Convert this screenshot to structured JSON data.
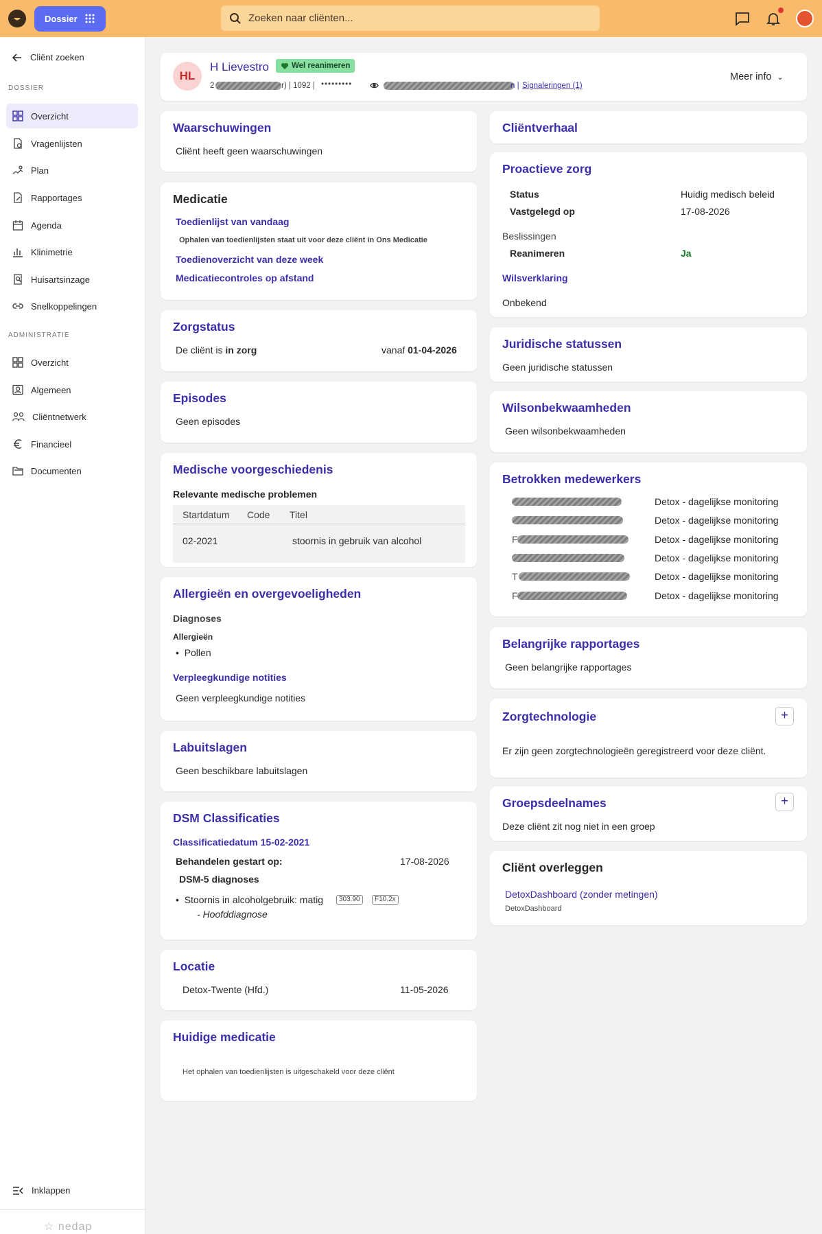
{
  "colors": {
    "topbar": "#f9bb6b",
    "accent": "#3a2fa8",
    "dossier_button": "#5b6cf2",
    "green": "#1c7a2a"
  },
  "topbar": {
    "dossier_label": "Dossier",
    "search_placeholder": "Zoeken naar cliënten..."
  },
  "sidebar": {
    "back_label": "Cliënt zoeken",
    "section_dossier": "DOSSIER",
    "dossier_items": [
      {
        "label": "Overzicht",
        "icon": "grid-icon",
        "active": true
      },
      {
        "label": "Vragenlijsten",
        "icon": "questionnaire-icon"
      },
      {
        "label": "Plan",
        "icon": "plan-icon"
      },
      {
        "label": "Rapportages",
        "icon": "report-icon"
      },
      {
        "label": "Agenda",
        "icon": "calendar-icon"
      },
      {
        "label": "Klinimetrie",
        "icon": "chart-icon"
      },
      {
        "label": "Huisartsinzage",
        "icon": "doctor-icon"
      },
      {
        "label": "Snelkoppelingen",
        "icon": "link-icon"
      }
    ],
    "section_admin": "ADMINISTRATIE",
    "admin_items": [
      {
        "label": "Overzicht",
        "icon": "grid-icon"
      },
      {
        "label": "Algemeen",
        "icon": "person-icon"
      },
      {
        "label": "Cliëntnetwerk",
        "icon": "network-icon"
      },
      {
        "label": "Financieel",
        "icon": "euro-icon"
      },
      {
        "label": "Documenten",
        "icon": "folder-icon"
      }
    ],
    "collapse_label": "Inklappen",
    "footer_brand": "nedap"
  },
  "client": {
    "initials": "HL",
    "name": "H Lievestro",
    "reanimeren_badge": "Wel reanimeren",
    "meta_prefix": "2",
    "meta_r": "r) | 1092 |",
    "meta_masked": "•••••••••",
    "meta_suffix": "n |",
    "signaleringen": "Signaleringen (1)",
    "meer_info": "Meer info"
  },
  "left": {
    "waarschuwingen": {
      "title": "Waarschuwingen",
      "text": "Cliënt heeft geen waarschuwingen"
    },
    "medicatie": {
      "title": "Medicatie",
      "link1": "Toedienlijst van vandaag",
      "note": "Ophalen van toedienlijsten staat uit voor deze cliënt in Ons Medicatie",
      "link2": "Toedienoverzicht van deze week",
      "link3": "Medicatiecontroles op afstand"
    },
    "zorgstatus": {
      "title": "Zorgstatus",
      "prefix": "De cliënt is",
      "status": "in zorg",
      "vanaf": "vanaf",
      "date": "01-04-2026"
    },
    "episodes": {
      "title": "Episodes",
      "text": "Geen episodes"
    },
    "voorgeschiedenis": {
      "title": "Medische voorgeschiedenis",
      "subtitle": "Relevante medische problemen",
      "headers": [
        "Startdatum",
        "Code",
        "Titel"
      ],
      "row": [
        "02-2021",
        "",
        "stoornis in gebruik van alcohol"
      ]
    },
    "allergieen": {
      "title": "Allergieën en overgevoeligheden",
      "diagnoses": "Diagnoses",
      "allergieen_label": "Allergieën",
      "item": "Pollen",
      "notities_link": "Verpleegkundige notities",
      "notities_text": "Geen verpleegkundige notities"
    },
    "labuitslagen": {
      "title": "Labuitslagen",
      "text": "Geen beschikbare labuitslagen"
    },
    "dsm": {
      "title": "DSM Classificaties",
      "date_label": "Classificatiedatum 15-02-2021",
      "behandelen_label": "Behandelen gestart op:",
      "behandelen_date": "17-08-2026",
      "dsm5": "DSM-5 diagnoses",
      "diagnose": "Stoornis in alcoholgebruik: matig",
      "code1": "303.90",
      "code2": "F10.2x",
      "hoofd": "- Hoofddiagnose"
    },
    "locatie": {
      "title": "Locatie",
      "name": "Detox-Twente (Hfd.)",
      "date": "11-05-2026"
    },
    "huidige_medicatie": {
      "title": "Huidige medicatie",
      "text": "Het ophalen van toedienlijsten is uitgeschakeld voor deze cliënt"
    }
  },
  "right": {
    "clientverhaal": {
      "title": "Cliëntverhaal"
    },
    "proactieve": {
      "title": "Proactieve zorg",
      "status_label": "Status",
      "status_value": "Huidig medisch beleid",
      "vastgelegd_label": "Vastgelegd op",
      "vastgelegd_value": "17-08-2026",
      "beslissingen": "Beslissingen",
      "reanimeren_label": "Reanimeren",
      "reanimeren_value": "Ja",
      "wilsverklaring": "Wilsverklaring",
      "onbekend": "Onbekend"
    },
    "juridische": {
      "title": "Juridische statussen",
      "text": "Geen juridische statussen"
    },
    "wilsonbekwaam": {
      "title": "Wilsonbekwaamheden",
      "text": "Geen wilsonbekwaamheden"
    },
    "betrokken": {
      "title": "Betrokken medewerkers",
      "rows": [
        {
          "initial": "",
          "role": "Detox - dagelijkse monitoring"
        },
        {
          "initial": "",
          "role": "Detox - dagelijkse monitoring"
        },
        {
          "initial": "F",
          "role": "Detox - dagelijkse monitoring"
        },
        {
          "initial": "",
          "role": "Detox - dagelijkse monitoring"
        },
        {
          "initial": "T",
          "role": "Detox - dagelijkse monitoring"
        },
        {
          "initial": "F",
          "role": "Detox - dagelijkse monitoring"
        }
      ]
    },
    "rapportages": {
      "title": "Belangrijke rapportages",
      "text": "Geen belangrijke rapportages"
    },
    "zorgtechnologie": {
      "title": "Zorgtechnologie",
      "text": "Er zijn geen zorgtechnologieën geregistreerd voor deze cliënt.",
      "plus": "+"
    },
    "groepsdeelnames": {
      "title": "Groepsdeelnames",
      "text": "Deze cliënt zit nog niet in een groep",
      "plus": "+"
    },
    "overleggen": {
      "title": "Cliënt overleggen",
      "link": "DetoxDashboard (zonder metingen)",
      "sub": "DetoxDashboard"
    }
  }
}
